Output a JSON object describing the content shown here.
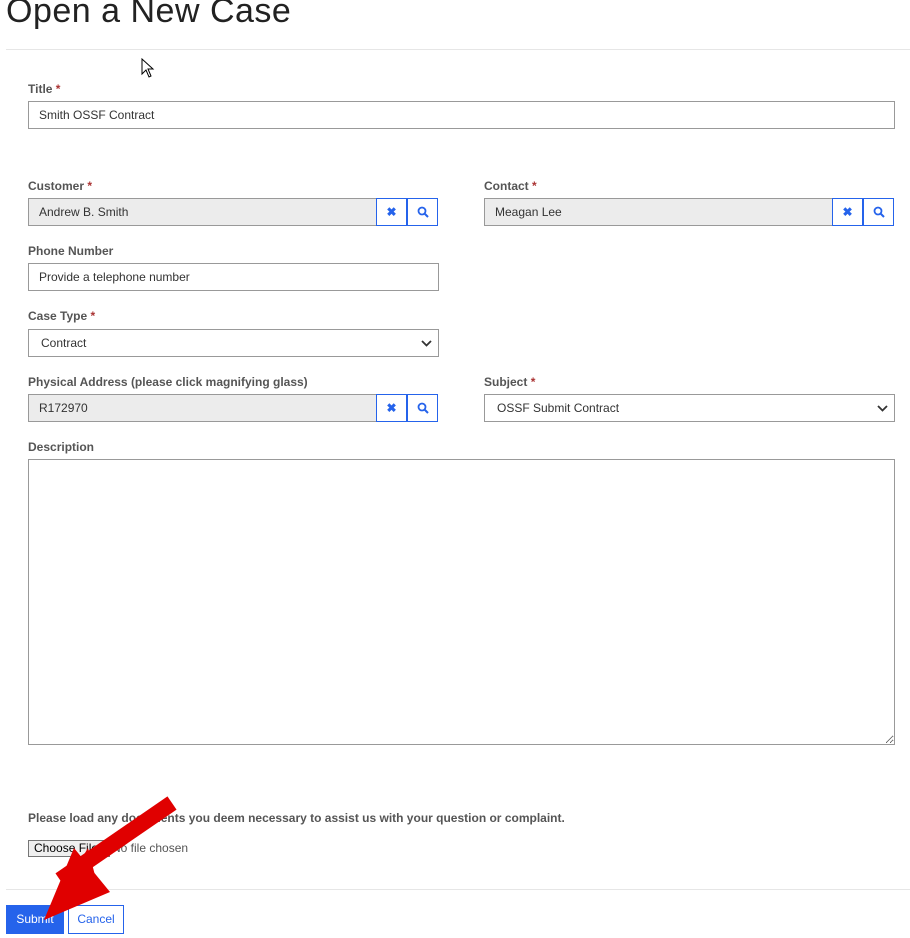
{
  "page_title": "Open a New Case",
  "fields": {
    "title": {
      "label": "Title",
      "required": "*",
      "value": "Smith OSSF Contract"
    },
    "customer": {
      "label": "Customer",
      "required": "*",
      "value": "Andrew B. Smith"
    },
    "contact": {
      "label": "Contact",
      "required": "*",
      "value": "Meagan Lee"
    },
    "phone": {
      "label": "Phone Number",
      "placeholder": "Provide a telephone number"
    },
    "case_type": {
      "label": "Case Type",
      "required": "*",
      "value": "Contract"
    },
    "address": {
      "label": "Physical Address (please click magnifying glass)",
      "value": "R172970"
    },
    "subject": {
      "label": "Subject",
      "required": "*",
      "value": "OSSF Submit Contract"
    },
    "description": {
      "label": "Description",
      "value": ""
    }
  },
  "icons": {
    "clear": "✖",
    "search": "⚲"
  },
  "upload": {
    "prompt": "Please load any documents you deem necessary to assist us with your question or complaint.",
    "button": "Choose Files",
    "status": "No file chosen"
  },
  "actions": {
    "submit": "Submit",
    "cancel": "Cancel"
  },
  "colors": {
    "accent": "#2563eb",
    "annotation_arrow": "#e00000"
  }
}
